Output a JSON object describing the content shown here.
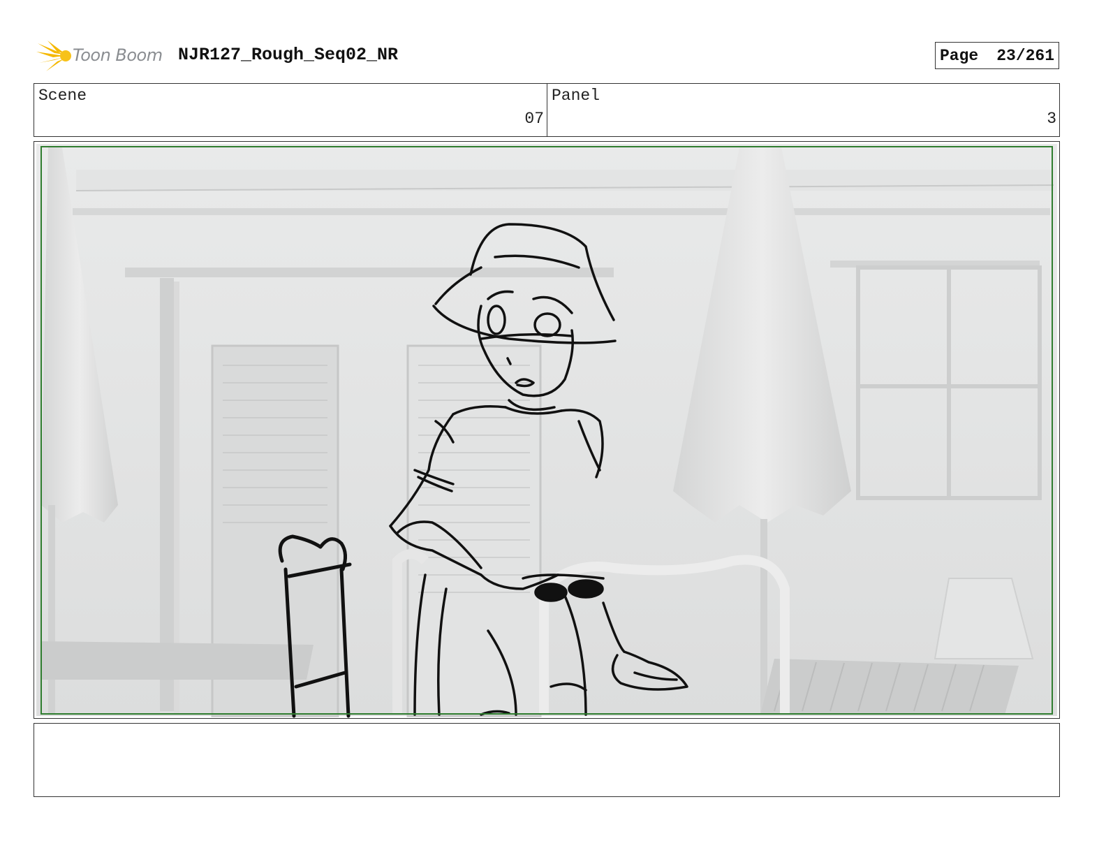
{
  "header": {
    "logo_text": "Toon Boom",
    "project_title": "NJR127_Rough_Seq02_NR",
    "page_label": "Page",
    "page_number": "23/261"
  },
  "meta": {
    "scene_label": "Scene",
    "scene_value": "07",
    "panel_label": "Panel",
    "panel_value": "3"
  },
  "notes": {
    "text": ""
  }
}
